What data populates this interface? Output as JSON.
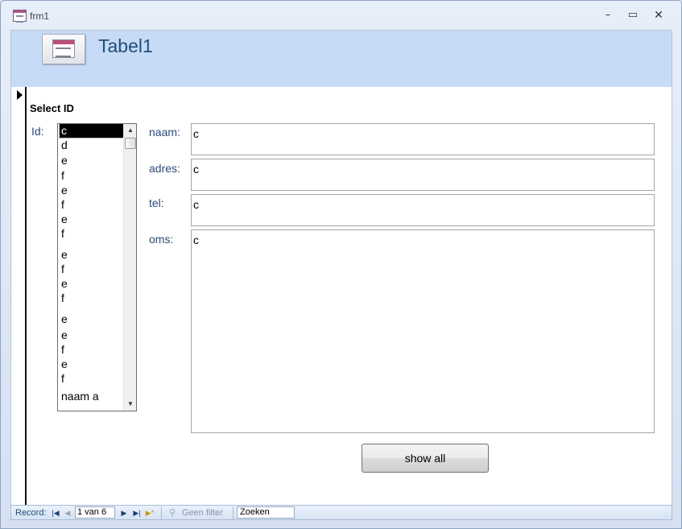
{
  "window": {
    "title": "frm1",
    "minimize_symbol": "–",
    "maximize_symbol": "▭",
    "close_symbol": "✕"
  },
  "header": {
    "title": "Tabel1",
    "icon": "form-icon"
  },
  "form": {
    "section_label": "Select ID",
    "id_label": "Id:",
    "id_list": {
      "items": [
        "c",
        "d",
        "e",
        "f",
        "e",
        "f",
        "e",
        "f",
        "e",
        "f",
        "e",
        "f",
        "e",
        "e",
        "f",
        "e",
        "f",
        "naam a"
      ],
      "selected": "c"
    },
    "fields": [
      {
        "key": "naam",
        "label": "naam:",
        "value": "c"
      },
      {
        "key": "adres",
        "label": "adres:",
        "value": "c"
      },
      {
        "key": "tel",
        "label": "tel:",
        "value": "c"
      },
      {
        "key": "oms",
        "label": "oms:",
        "value": "c"
      }
    ],
    "show_all_label": "show all"
  },
  "navigation": {
    "record_label": "Record:",
    "current": "1 van 6",
    "first_icon": "first-record-icon",
    "prev_icon": "previous-record-icon",
    "next_icon": "next-record-icon",
    "last_icon": "last-record-icon",
    "new_icon": "new-record-icon",
    "filter_label": "Geen filter",
    "search_placeholder": "Zoeken"
  },
  "colors": {
    "header_bg": "#c7dbf6",
    "label_text": "#2b4a79",
    "title_text": "#1f4e79"
  }
}
